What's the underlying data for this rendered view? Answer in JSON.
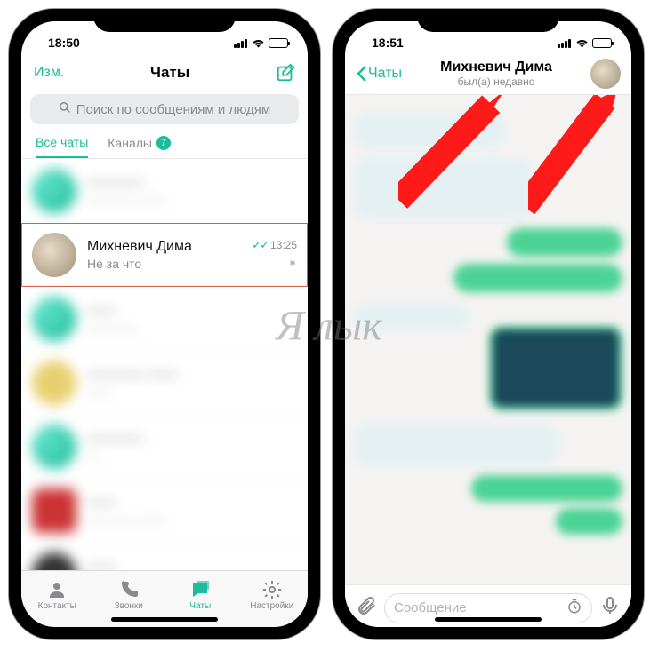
{
  "colors": {
    "accent": "#1bbc9b",
    "highlight_border": "#d66049",
    "arrow": "#ff1a1a"
  },
  "watermark": "Я  лык",
  "left": {
    "status_time": "18:50",
    "edit_label": "Изм.",
    "title": "Чаты",
    "search_placeholder": "Поиск по сообщениям и людям",
    "tabs": {
      "all": "Все чаты",
      "channels": "Каналы",
      "channels_badge": "7"
    },
    "highlight_row": {
      "name": "Михневич Дима",
      "preview": "Не за что",
      "time": "13:25",
      "read_checks": "✓✓",
      "pinned": true
    },
    "tabbar": {
      "contacts": "Контакты",
      "calls": "Звонки",
      "chats": "Чаты",
      "settings": "Настройки"
    }
  },
  "right": {
    "status_time": "18:51",
    "back_label": "Чаты",
    "contact_name": "Михневич Дима",
    "contact_status": "был(а) недавно",
    "input_placeholder": "Сообщение"
  }
}
